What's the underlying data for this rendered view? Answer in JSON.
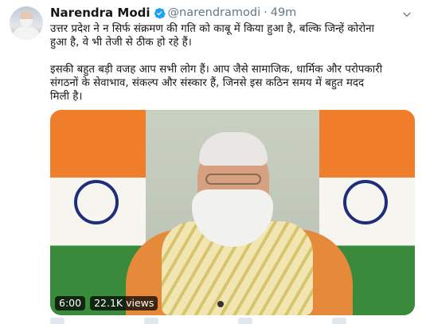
{
  "tweet": {
    "author": {
      "name": "Narendra Modi",
      "handle": "@narendramodi",
      "verified_icon": "verified-badge-icon"
    },
    "separator": "·",
    "time": "49m",
    "text": {
      "para1_line1": "उत्तर प्रदेश ने न सिर्फ संक्रमण की गति को काबू में किया हुआ है, बल्कि जिन्हें कोरोना",
      "para1_line2": "हुआ है, वे भी तेजी से ठीक हो रहे हैं।",
      "para2_line1": "इसकी बहुत बड़ी वजह आप सभी लोग हैं। आप जैसे सामाजिक, धार्मिक और परोपकारी",
      "para2_line2": "संगठनों के सेवाभाव, संकल्प और संस्कार हैं, जिनसे इस कठिन समय में बहुत मदद",
      "para2_line3": "मिली है।"
    },
    "media": {
      "duration": "6:00",
      "views": "22.1K views"
    },
    "menu_icon": "chevron-down-icon"
  },
  "colors": {
    "accent": "#1da1f2",
    "muted_text": "#657786",
    "primary_text": "#14171a"
  }
}
